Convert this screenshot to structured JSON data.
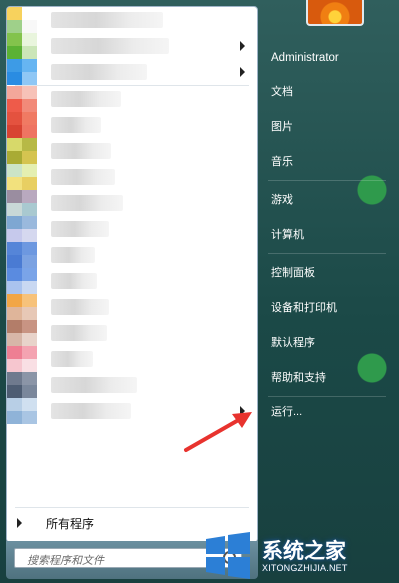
{
  "start_menu": {
    "user_name": "Administrator",
    "right_items": [
      {
        "label": "文档"
      },
      {
        "label": "图片"
      },
      {
        "label": "音乐"
      },
      {
        "label": "游戏"
      },
      {
        "label": "计算机"
      },
      {
        "label": "控制面板"
      },
      {
        "label": "设备和打印机"
      },
      {
        "label": "默认程序"
      },
      {
        "label": "帮助和支持"
      },
      {
        "label": "运行..."
      }
    ],
    "all_programs_label": "所有程序",
    "search_placeholder": "搜索程序和文件"
  },
  "watermark": {
    "title": "系统之家",
    "url": "XITONGZHIJIA.NET"
  },
  "colors": {
    "arrow": "#e8332e",
    "text_light": "#ffffff"
  }
}
